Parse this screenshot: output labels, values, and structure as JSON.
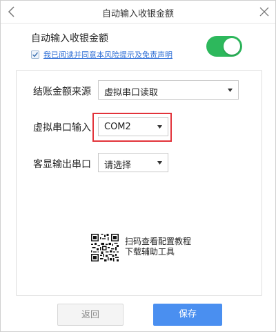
{
  "window": {
    "title": "自动输入收银金额"
  },
  "auto_input": {
    "label": "自动输入收银金额",
    "agreement_text": "我已阅读并同意本风险提示及免责声明",
    "agreement_checked": true,
    "enabled": true,
    "toggle_color": "#2db85c"
  },
  "form": {
    "amount_source": {
      "label": "结账金额来源",
      "value": "虚拟串口读取"
    },
    "virtual_port": {
      "label": "虚拟串口输入",
      "value": "COM2",
      "highlight_color": "#e2333a"
    },
    "display_port": {
      "label": "客显输出串口",
      "value": "请选择"
    }
  },
  "help": {
    "line1": "扫码查看配置教程",
    "line2": "下载辅助工具"
  },
  "buttons": {
    "back": "返回",
    "save": "保存",
    "save_color": "#4a8ff0"
  },
  "icons": {
    "back": "chevron-left-icon",
    "close": "close-icon",
    "qr": "qr-code-icon"
  }
}
